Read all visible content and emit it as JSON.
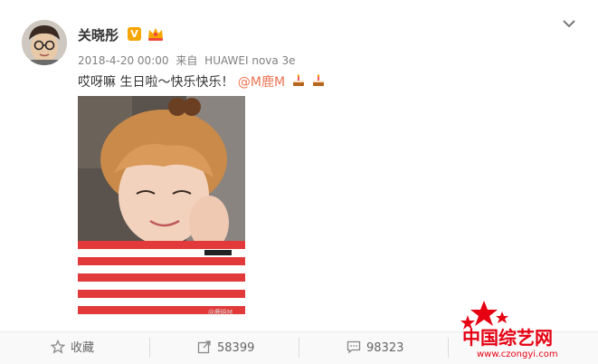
{
  "post": {
    "username": "关晓彤",
    "verified_badge": "V",
    "date": "2018-4-20 00:00",
    "source_prefix": "来自",
    "source": "HUAWEI nova 3e",
    "text": "哎呀嘛 生日啦～快乐快乐！",
    "mention": "@M鹿M",
    "photo_watermark": "@鹿晗M"
  },
  "actions": {
    "favorite_label": "收藏",
    "repost_count": "58399",
    "comment_count": "98323"
  },
  "site_logo": {
    "name": "中国综艺网",
    "url": "www.czongyi.com"
  },
  "colors": {
    "mention": "#eb7350",
    "badge": "#f7a600",
    "logo_red": "#e60012"
  }
}
